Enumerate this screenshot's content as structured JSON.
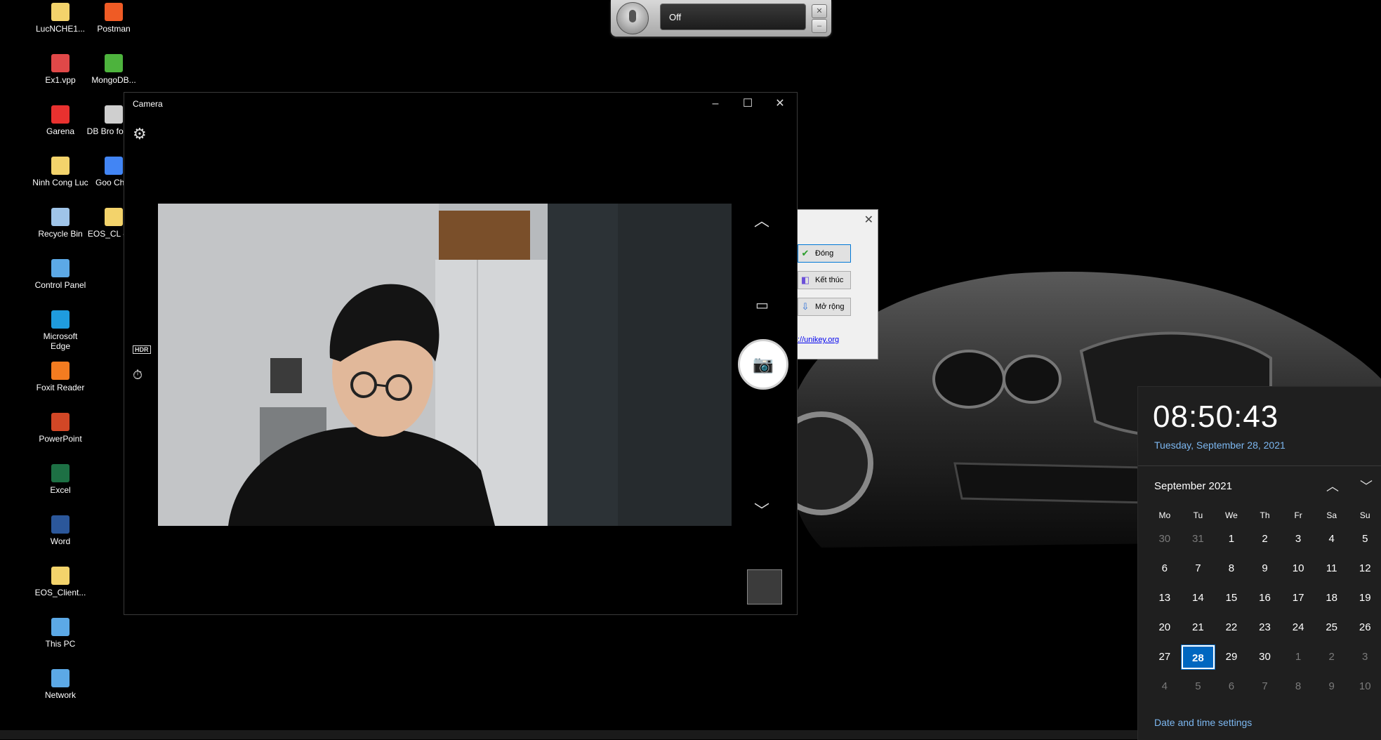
{
  "desktop": {
    "icons": [
      {
        "label": "LucNCHE1...",
        "icon": "folder-icon",
        "color": "#f3d36b"
      },
      {
        "label": "Postman",
        "icon": "postman-icon",
        "color": "#ef5b25"
      },
      {
        "label": "Ex1.vpp",
        "icon": "vpp-file-icon",
        "color": "#e04848"
      },
      {
        "label": "MongoDB...",
        "icon": "mongodb-icon",
        "color": "#4db33d"
      },
      {
        "label": "Garena",
        "icon": "garena-icon",
        "color": "#e8312f"
      },
      {
        "label": "DB Bro for SQ",
        "icon": "db-browser-icon",
        "color": "#cfcfcf"
      },
      {
        "label": "Ninh Cong Luc",
        "icon": "user-folder-icon",
        "color": "#f3d36b"
      },
      {
        "label": "Goo Chro",
        "icon": "chrome-icon",
        "color": "#4285f4"
      },
      {
        "label": "Recycle Bin",
        "icon": "recycle-bin-icon",
        "color": "#9fc4e8"
      },
      {
        "label": "EOS_CL - tu_",
        "icon": "folder-icon",
        "color": "#f3d36b"
      },
      {
        "label": "Control Panel",
        "icon": "control-panel-icon",
        "color": "#5ca9e6"
      },
      {
        "label": "Microsoft Edge",
        "icon": "edge-icon",
        "color": "#1f9cde"
      },
      {
        "label": "Foxit Reader",
        "icon": "foxit-icon",
        "color": "#f47c20"
      },
      {
        "label": "PowerPoint",
        "icon": "powerpoint-icon",
        "color": "#d24726"
      },
      {
        "label": "Excel",
        "icon": "excel-icon",
        "color": "#1d7044"
      },
      {
        "label": "Word",
        "icon": "word-icon",
        "color": "#2b579a"
      },
      {
        "label": "EOS_Client...",
        "icon": "folder-icon",
        "color": "#f3d36b"
      },
      {
        "label": "This PC",
        "icon": "this-pc-icon",
        "color": "#5ca9e6"
      },
      {
        "label": "Network",
        "icon": "network-icon",
        "color": "#5ca9e6"
      }
    ]
  },
  "voice_widget": {
    "status": "Off",
    "close": "✕",
    "minimize": "–"
  },
  "unikey": {
    "close": "✕",
    "buttons": [
      {
        "label": "Đóng",
        "icon": "check-icon",
        "glyph": "✔"
      },
      {
        "label": "Kết thúc",
        "icon": "exit-icon",
        "glyph": "◧"
      },
      {
        "label": "Mở rộng",
        "icon": "expand-icon",
        "glyph": "⇩"
      }
    ],
    "link": "://unikey.org"
  },
  "camera": {
    "title": "Camera",
    "minimize": "–",
    "maximize": "☐",
    "close": "✕",
    "settings_glyph": "⚙",
    "hdr": "HDR",
    "timer_glyph": "⏱",
    "chevron_up": "︿",
    "chevron_down": "﹀",
    "video_glyph": "▭",
    "photo_glyph": "📷"
  },
  "clock": {
    "time": "08:50:43",
    "date": "Tuesday, September 28, 2021",
    "month": "September 2021",
    "nav_up": "︿",
    "nav_down": "﹀",
    "weekdays": [
      "Mo",
      "Tu",
      "We",
      "Th",
      "Fr",
      "Sa",
      "Su"
    ],
    "weeks": [
      [
        {
          "d": "30",
          "dim": true
        },
        {
          "d": "31",
          "dim": true
        },
        {
          "d": "1"
        },
        {
          "d": "2"
        },
        {
          "d": "3"
        },
        {
          "d": "4"
        },
        {
          "d": "5"
        }
      ],
      [
        {
          "d": "6"
        },
        {
          "d": "7"
        },
        {
          "d": "8"
        },
        {
          "d": "9"
        },
        {
          "d": "10"
        },
        {
          "d": "11"
        },
        {
          "d": "12"
        }
      ],
      [
        {
          "d": "13"
        },
        {
          "d": "14"
        },
        {
          "d": "15"
        },
        {
          "d": "16"
        },
        {
          "d": "17"
        },
        {
          "d": "18"
        },
        {
          "d": "19"
        }
      ],
      [
        {
          "d": "20"
        },
        {
          "d": "21"
        },
        {
          "d": "22"
        },
        {
          "d": "23"
        },
        {
          "d": "24"
        },
        {
          "d": "25"
        },
        {
          "d": "26"
        }
      ],
      [
        {
          "d": "27"
        },
        {
          "d": "28",
          "today": true
        },
        {
          "d": "29"
        },
        {
          "d": "30"
        },
        {
          "d": "1",
          "dim": true
        },
        {
          "d": "2",
          "dim": true
        },
        {
          "d": "3",
          "dim": true
        }
      ],
      [
        {
          "d": "4",
          "dim": true
        },
        {
          "d": "5",
          "dim": true
        },
        {
          "d": "6",
          "dim": true
        },
        {
          "d": "7",
          "dim": true
        },
        {
          "d": "8",
          "dim": true
        },
        {
          "d": "9",
          "dim": true
        },
        {
          "d": "10",
          "dim": true
        }
      ]
    ],
    "settings_link": "Date and time settings",
    "accent": "#0067c0",
    "link_color": "#7cb7f0"
  }
}
